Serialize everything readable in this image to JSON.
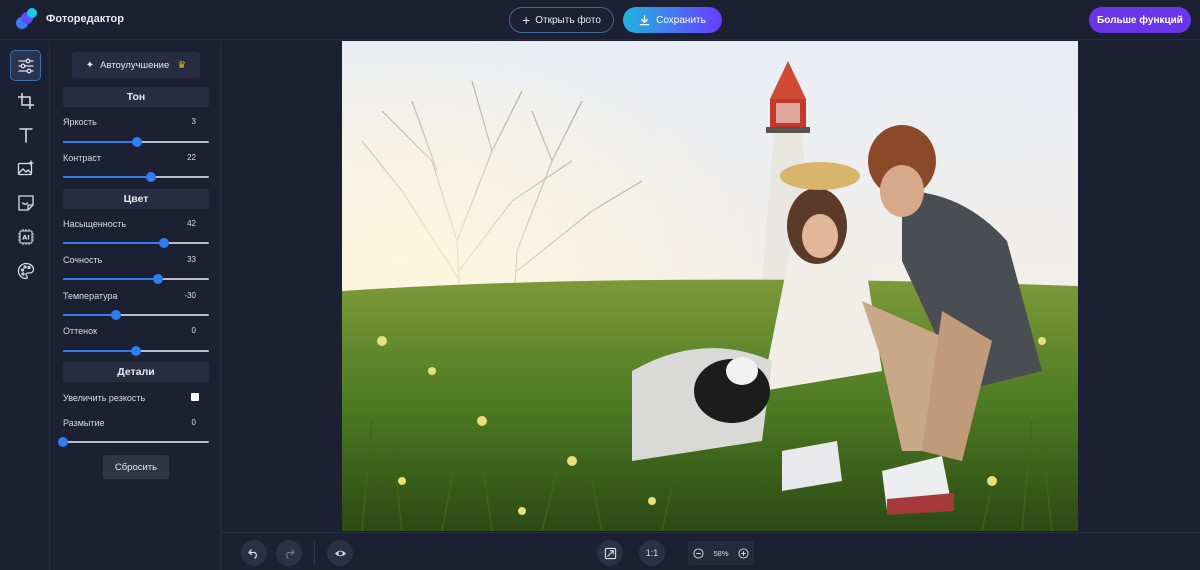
{
  "app": {
    "title": "Фоторедактор"
  },
  "header": {
    "open_photo_label": "Открыть фото",
    "save_label": "Сохранить",
    "more_features_label": "Больше функций"
  },
  "toolbar": {
    "tools": [
      {
        "icon": "sliders-icon",
        "active": true
      },
      {
        "icon": "crop-icon",
        "active": false
      },
      {
        "icon": "text-icon",
        "active": false
      },
      {
        "icon": "image-add-icon",
        "active": false
      },
      {
        "icon": "sticker-icon",
        "active": false
      },
      {
        "icon": "ai-chip-icon",
        "active": false
      },
      {
        "icon": "palette-icon",
        "active": false
      }
    ]
  },
  "panel": {
    "auto_enhance_label": "Автоулучшение",
    "tone": {
      "title": "Тон",
      "brightness": {
        "label": "Яркость",
        "value": "3",
        "level": 0.51
      },
      "contrast": {
        "label": "Контраст",
        "value": "22",
        "level": 0.6
      }
    },
    "color": {
      "title": "Цвет",
      "saturation": {
        "label": "Насыщенность",
        "value": "42",
        "level": 0.69
      },
      "vibrance": {
        "label": "Сочность",
        "value": "33",
        "level": 0.65
      },
      "temperature": {
        "label": "Температура",
        "value": "-30",
        "level": 0.36
      },
      "tint": {
        "label": "Оттенок",
        "value": "0",
        "level": 0.5
      }
    },
    "details": {
      "title": "Детали",
      "sharpen": {
        "label": "Увеличить резкость",
        "checked": false
      },
      "blur": {
        "label": "Размытие",
        "value": "0",
        "level": 0.0
      }
    },
    "reset_label": "Сбросить"
  },
  "bottom": {
    "ratio_label": "1:1",
    "zoom_label": "58%"
  },
  "colors": {
    "accent": "#2f7df0",
    "more_button": "#6a35e8",
    "save_gradient_start": "#1fb5e0",
    "save_gradient_end": "#6a3bff",
    "background": "#1b2132"
  }
}
